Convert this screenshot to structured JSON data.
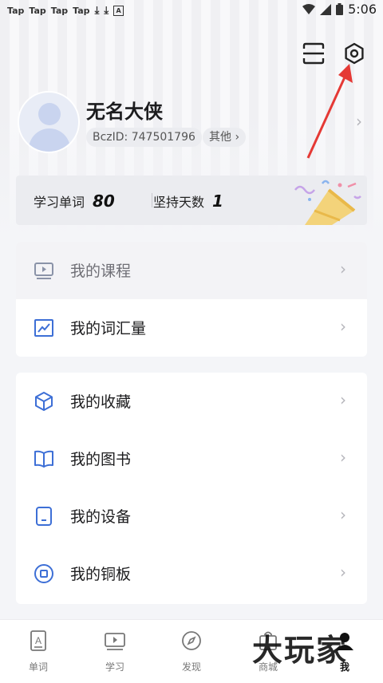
{
  "status_bar": {
    "left_items": [
      "Tap",
      "Tap",
      "Tap",
      "Tap"
    ],
    "time": "5:06"
  },
  "profile": {
    "username": "无名大侠",
    "bczid": "BczID: 747501796",
    "other_label": "其他 ›"
  },
  "stats": {
    "words_label": "学习单词",
    "words_value": "80",
    "days_label": "坚持天数",
    "days_value": "1"
  },
  "menu_group_1": [
    {
      "label": "我的课程",
      "icon": "video-course-icon",
      "disabled": true
    },
    {
      "label": "我的词汇量",
      "icon": "chart-trend-icon",
      "disabled": false
    }
  ],
  "menu_group_2": [
    {
      "label": "我的收藏",
      "icon": "cube-icon"
    },
    {
      "label": "我的图书",
      "icon": "book-icon"
    },
    {
      "label": "我的设备",
      "icon": "device-icon"
    },
    {
      "label": "我的铜板",
      "icon": "coin-icon"
    }
  ],
  "chevron": "›",
  "tabbar": [
    {
      "label": "单词",
      "icon": "word-card-icon"
    },
    {
      "label": "学习",
      "icon": "study-screen-icon"
    },
    {
      "label": "发现",
      "icon": "compass-icon"
    },
    {
      "label": "商城",
      "icon": "shop-icon"
    },
    {
      "label": "我",
      "icon": "profile-icon",
      "active": true
    }
  ],
  "watermark": "大玩家",
  "colors": {
    "accent_blue": "#3d6fd6",
    "annotation_red": "#e53935"
  }
}
